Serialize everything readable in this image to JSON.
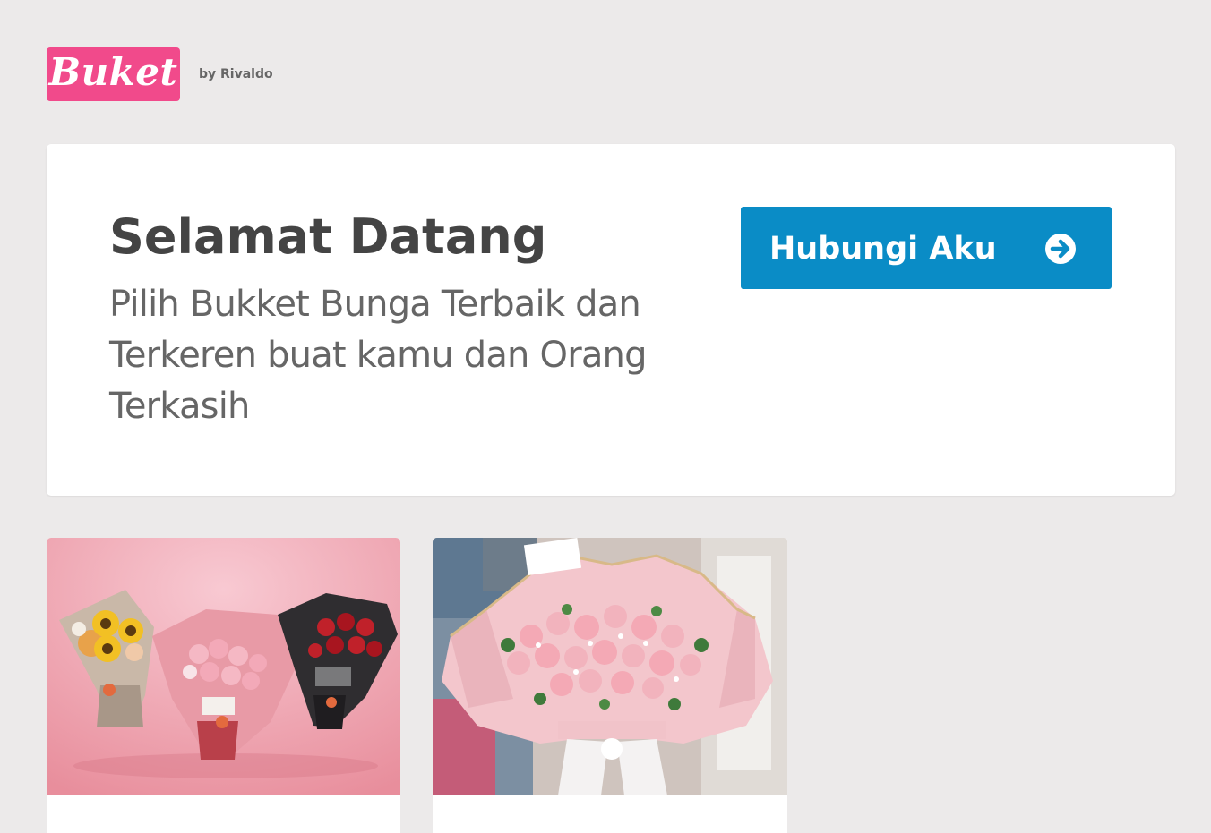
{
  "brand": {
    "logo_text": "Buket",
    "byline": "by Rivaldo",
    "logo_color": "#f14a8b"
  },
  "hero": {
    "title": "Selamat Datang",
    "subtitle": "Pilih Bukket Bunga Terbaik dan Terkeren buat kamu dan Orang Terkasih",
    "cta_label": "Hubungi Aku",
    "cta_icon": "arrow-circle-right-icon",
    "cta_color": "#0a8cc6"
  },
  "products": [
    {
      "image": "three-bouquets-sunflower-pink-rose-red-rose-photo"
    },
    {
      "image": "large-pink-rose-bouquet-photo"
    }
  ]
}
